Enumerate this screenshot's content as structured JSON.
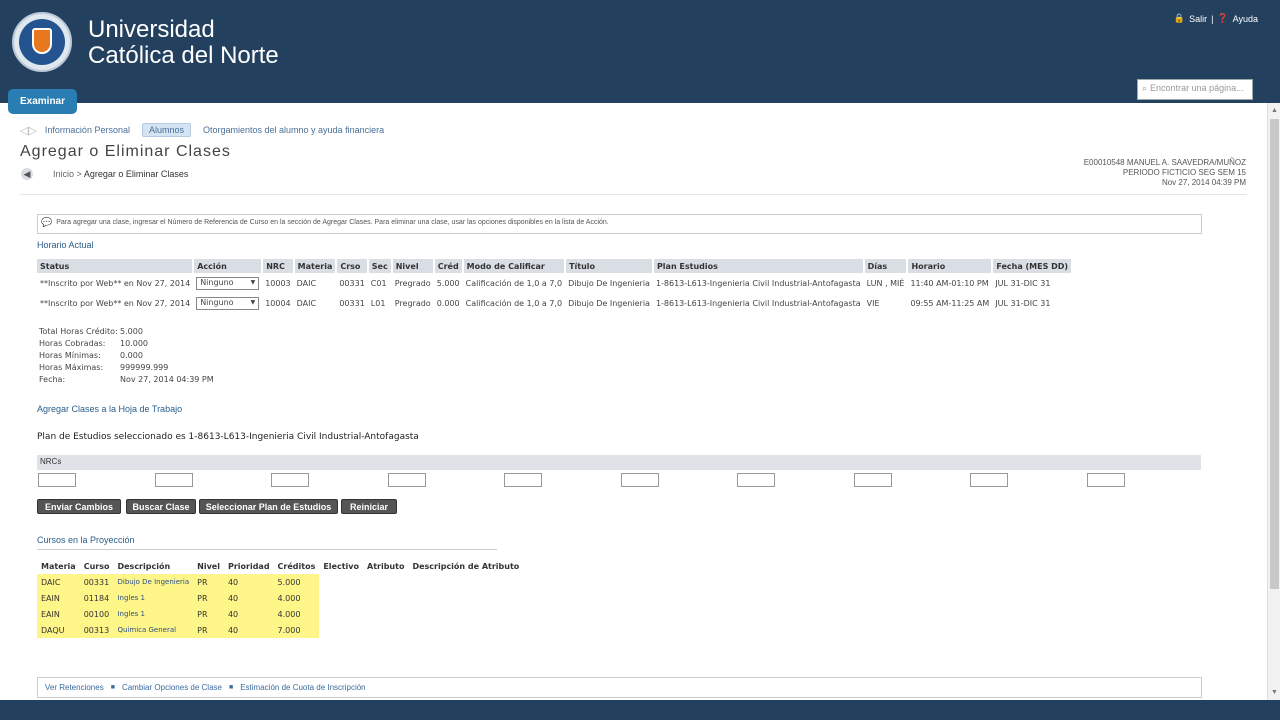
{
  "header": {
    "uni_line1": "Universidad",
    "uni_line2": "Católica del Norte",
    "salir": "Salir",
    "separator": "|",
    "ayuda": "Ayuda",
    "search_placeholder": "Encontrar una página...",
    "examinar": "Examinar"
  },
  "nav": {
    "items": [
      "Información Personal",
      "Alumnos",
      "Otorgamientos del alumno y ayuda financiera"
    ],
    "active": "Alumnos"
  },
  "page": {
    "title": "Agregar o Eliminar Clases",
    "crumb_home": "Inicio",
    "crumb_sep": ">",
    "crumb_current": "Agregar o Eliminar Clases"
  },
  "user": {
    "line1": "E00010548 MANUEL A. SAAVEDRA/MUÑOZ",
    "line2": "PERIODO FICTICIO SEG SEM 15",
    "line3": "Nov 27, 2014 04:39 PM"
  },
  "info": "Para agregar una clase, ingresar el Número de Referencia de Curso en la sección de Agregar Clases. Para eliminar una clase, usar las opciones disponibles en la lista de Acción.",
  "horario": {
    "title": "Horario Actual",
    "headers": [
      "Status",
      "Acción",
      "NRC",
      "Materia",
      "Crso",
      "Sec",
      "Nivel",
      "Créd",
      "Modo de Calificar",
      "Título",
      "Plan Estudios",
      "Días",
      "Horario",
      "Fecha (MES DD)"
    ],
    "rows": [
      [
        "**Inscrito por Web** en Nov 27, 2014",
        "Ninguno",
        "10003",
        "DAIC",
        "00331",
        "C01",
        "Pregrado",
        "5.000",
        "Calificación de 1,0 a 7,0",
        "Dibujo De Ingenieria",
        "1-8613-L613-Ingenieria Civil Industrial-Antofagasta",
        "LUN , MIÉ",
        "11:40 AM-01:10 PM",
        "JUL 31-DIC 31"
      ],
      [
        "**Inscrito por Web** en Nov 27, 2014",
        "Ninguno",
        "10004",
        "DAIC",
        "00331",
        "L01",
        "Pregrado",
        "0.000",
        "Calificación de 1,0 a 7,0",
        "Dibujo De Ingenieria",
        "1-8613-L613-Ingenieria Civil Industrial-Antofagasta",
        "VIE",
        "09:55 AM-11:25 AM",
        "JUL 31-DIC 31"
      ]
    ]
  },
  "totals": [
    {
      "k": "Total Horas Crédito:",
      "v": "5.000"
    },
    {
      "k": "Horas Cobradas:",
      "v": "10.000"
    },
    {
      "k": "Horas Mínimas:",
      "v": "0.000"
    },
    {
      "k": "Horas Máximas:",
      "v": "999999.999"
    },
    {
      "k": "Fecha:",
      "v": "Nov 27, 2014 04:39 PM"
    }
  ],
  "agregar": {
    "title": "Agregar Clases a la Hoja de Trabajo",
    "plan_text": "Plan de Estudios seleccionado es 1-8613-L613-Ingenieria Civil Industrial-Antofagasta",
    "nrcs_label": "NRCs"
  },
  "buttons": [
    "Enviar Cambios",
    "Buscar Clase",
    "Seleccionar Plan de Estudios",
    "Reiniciar"
  ],
  "cursos": {
    "title": "Cursos en la Proyección",
    "headers": [
      "Materia",
      "Curso",
      "Descripción",
      "Nivel",
      "Prioridad",
      "Créditos",
      "Electivo",
      "Atributo",
      "Descripción de Atributo"
    ],
    "rows": [
      [
        "DAIC",
        "00331",
        "Dibujo De Ingenieria",
        "PR",
        "40",
        "5.000"
      ],
      [
        "EAIN",
        "01184",
        "Ingles 1",
        "PR",
        "40",
        "4.000"
      ],
      [
        "EAIN",
        "00100",
        "Ingles 1",
        "PR",
        "40",
        "4.000"
      ],
      [
        "DAQU",
        "00313",
        "Quimica General",
        "PR",
        "40",
        "7.000"
      ]
    ]
  },
  "footer": [
    "Ver Retenciones",
    "Cambiar Opciones de Clase",
    "Estimación de Cuota de Inscripción"
  ],
  "colors": {
    "header": "#23405f",
    "accent": "#2a7db3",
    "highlight": "#fff68a"
  },
  "icons": [
    "lock-icon",
    "help-icon",
    "search-icon",
    "back-arrow-icon",
    "info-icon",
    "dropdown-arrow-icon"
  ]
}
